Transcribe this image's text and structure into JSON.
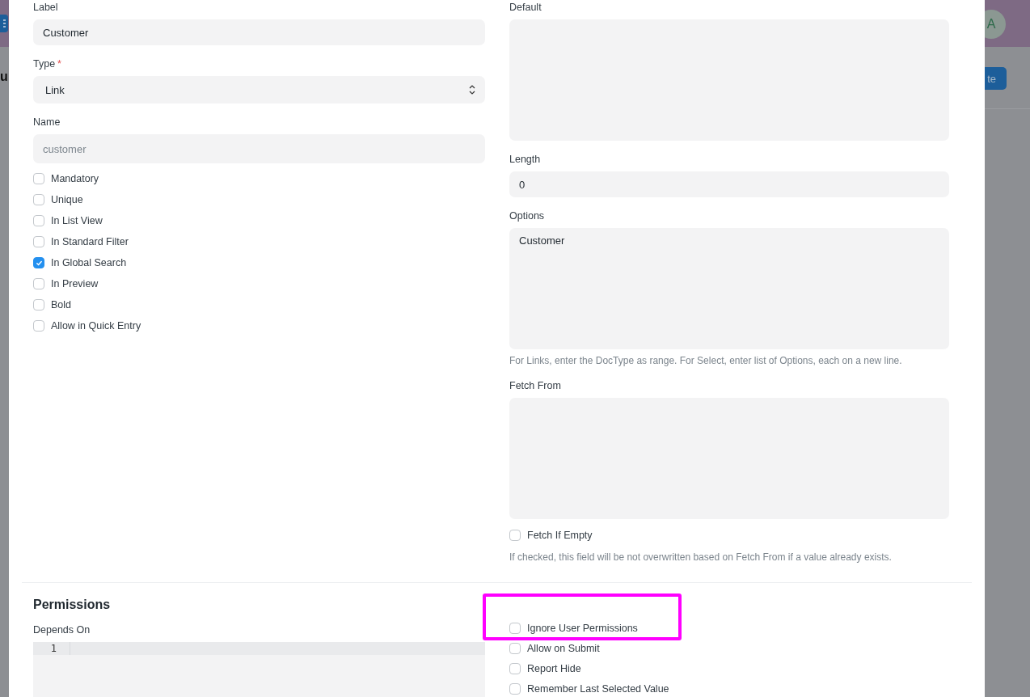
{
  "background": {
    "heading_fragment": "u",
    "avatar": "A",
    "button_fragment": "te"
  },
  "dialog": {
    "left": [
      {
        "kind": "input",
        "label": "Label",
        "value": "Customer"
      },
      {
        "kind": "select",
        "label": "Type",
        "required_mark": "*",
        "value": "Link"
      },
      {
        "kind": "readonly",
        "label": "Name",
        "value": "customer"
      },
      {
        "kind": "checkbox",
        "label": "Mandatory",
        "checked": false
      },
      {
        "kind": "checkbox",
        "label": "Unique",
        "checked": false
      },
      {
        "kind": "checkbox",
        "label": "In List View",
        "checked": false
      },
      {
        "kind": "checkbox",
        "label": "In Standard Filter",
        "checked": false
      },
      {
        "kind": "checkbox",
        "label": "In Global Search",
        "checked": true
      },
      {
        "kind": "checkbox",
        "label": "In Preview",
        "checked": false
      },
      {
        "kind": "checkbox",
        "label": "Bold",
        "checked": false
      },
      {
        "kind": "checkbox",
        "label": "Allow in Quick Entry",
        "checked": false
      }
    ],
    "right": [
      {
        "kind": "textarea",
        "label": "Default"
      },
      {
        "kind": "input",
        "label": "Length",
        "value": "0"
      },
      {
        "kind": "textarea",
        "label": "Options",
        "value": "Customer",
        "help": "For Links, enter the DocType as range. For Select, enter list of Options, each on a new line."
      },
      {
        "kind": "textarea",
        "label": "Fetch From"
      },
      {
        "kind": "checkbox",
        "label": "Fetch If Empty",
        "checked": false,
        "help": "If checked, this field will be not overwritten based on Fetch From if a value already exists."
      }
    ],
    "permissions": {
      "title": "Permissions",
      "depends_on": {
        "label": "Depends On",
        "line_numbers": [
          "1"
        ]
      },
      "options": [
        {
          "label": "Ignore User Permissions",
          "checked": false,
          "highlighted": true
        },
        {
          "label": "Allow on Submit",
          "checked": false,
          "highlighted": false
        },
        {
          "label": "Report Hide",
          "checked": false,
          "highlighted": false
        },
        {
          "label": "Remember Last Selected Value",
          "checked": false,
          "highlighted": false
        }
      ]
    }
  }
}
